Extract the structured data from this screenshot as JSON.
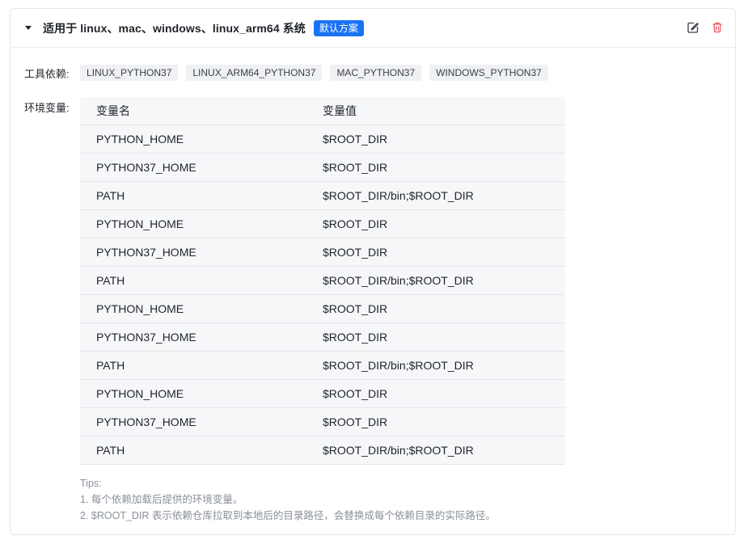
{
  "header": {
    "title": "适用于 linux、mac、windows、linux_arm64 系统",
    "badge": "默认方案"
  },
  "deps": {
    "label": "工具依赖:",
    "items": [
      "LINUX_PYTHON37",
      "LINUX_ARM64_PYTHON37",
      "MAC_PYTHON37",
      "WINDOWS_PYTHON37"
    ]
  },
  "env": {
    "label": "环境变量:",
    "columns": [
      "变量名",
      "变量值"
    ],
    "rows": [
      [
        "PYTHON_HOME",
        "$ROOT_DIR"
      ],
      [
        "PYTHON37_HOME",
        "$ROOT_DIR"
      ],
      [
        "PATH",
        "$ROOT_DIR/bin;$ROOT_DIR"
      ],
      [
        "PYTHON_HOME",
        "$ROOT_DIR"
      ],
      [
        "PYTHON37_HOME",
        "$ROOT_DIR"
      ],
      [
        "PATH",
        "$ROOT_DIR/bin;$ROOT_DIR"
      ],
      [
        "PYTHON_HOME",
        "$ROOT_DIR"
      ],
      [
        "PYTHON37_HOME",
        "$ROOT_DIR"
      ],
      [
        "PATH",
        "$ROOT_DIR/bin;$ROOT_DIR"
      ],
      [
        "PYTHON_HOME",
        "$ROOT_DIR"
      ],
      [
        "PYTHON37_HOME",
        "$ROOT_DIR"
      ],
      [
        "PATH",
        "$ROOT_DIR/bin;$ROOT_DIR"
      ]
    ]
  },
  "tips": {
    "title": "Tips:",
    "lines": [
      "1. 每个依赖加载后提供的环境变量。",
      "2. $ROOT_DIR 表示依赖仓库拉取到本地后的目录路径，会替换成每个依赖目录的实际路径。"
    ]
  },
  "icons": {
    "edit": "edit-icon",
    "delete": "trash-icon",
    "collapse": "caret-down-icon"
  },
  "colors": {
    "accent": "#1a73f5",
    "danger": "#f0505a"
  }
}
